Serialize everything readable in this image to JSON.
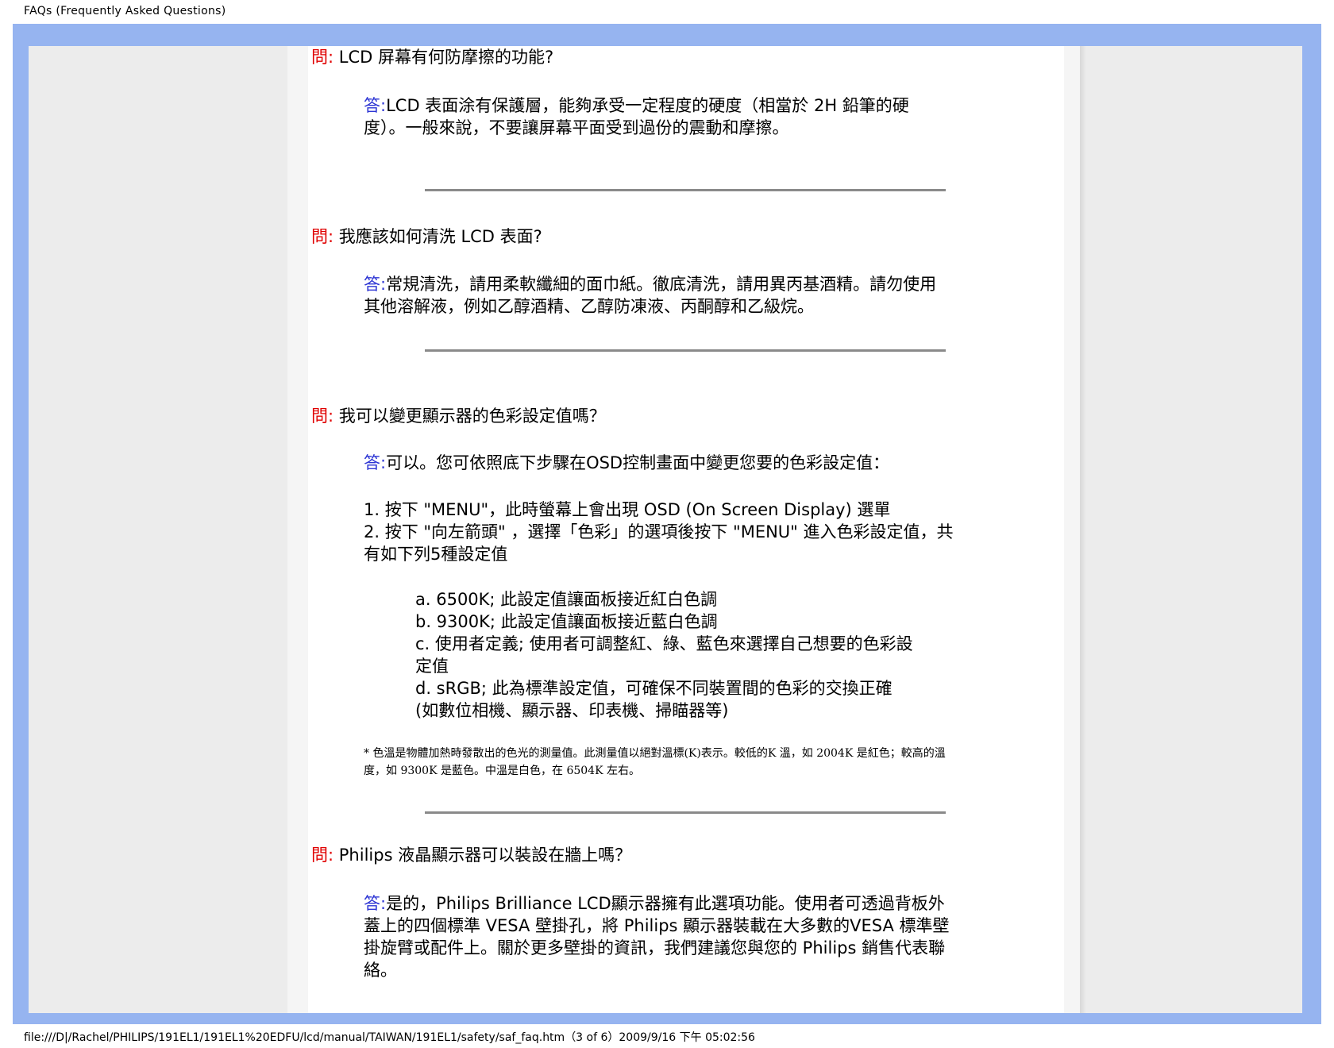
{
  "header": {
    "title": "FAQs (Frequently Asked Questions)"
  },
  "labels": {
    "q": "問:",
    "a": "答:"
  },
  "faq1": {
    "question": "LCD 屏幕有何防摩擦的功能?",
    "answer_l1": "LCD 表面涂有保護層，能夠承受一定程度的硬度（相當於 2H 鉛筆的硬",
    "answer_l2": "度）。一般來說，不要讓屏幕平面受到過份的震動和摩擦。"
  },
  "faq2": {
    "question": "我應該如何清洗 LCD 表面?",
    "answer_l1": "常規清洗，請用柔軟纖細的面巾紙。徹底清洗，請用異丙基酒精。請勿使用",
    "answer_l2": "其他溶解液，例如乙醇酒精、乙醇防凍液、丙酮醇和乙級烷。"
  },
  "faq3": {
    "question": "我可以變更顯示器的色彩設定值嗎？",
    "answer": "可以。您可依照底下步驟在OSD控制畫面中變更您要的色彩設定值：",
    "step1": "1. 按下 \"MENU\"，此時螢幕上會出現 OSD (On Screen Display) 選單",
    "step2_l1": "2. 按下 \"向左箭頭\" ，選擇「色彩」的選項後按下 \"MENU\" 進入色彩設定值，共",
    "step2_l2": "有如下列5種設定值",
    "opt_a": "a. 6500K; 此設定值讓面板接近紅白色調",
    "opt_b": "b. 9300K; 此設定值讓面板接近藍白色調",
    "opt_c_l1": "c. 使用者定義; 使用者可調整紅、綠、藍色來選擇自己想要的色彩設",
    "opt_c_l2": "定值",
    "opt_d_l1": "d. sRGB; 此為標準設定值，可確保不同裝置間的色彩的交換正確",
    "opt_d_l2": "(如數位相機、顯示器、印表機、掃瞄器等)",
    "note_l1": "* 色溫是物體加熱時發散出的色光的測量值。此測量值以絕對溫標(K)表示。較低的K 溫，如 2004K 是紅色；較高的溫",
    "note_l2": "度，如 9300K 是藍色。中溫是白色，在 6504K 左右。"
  },
  "faq4": {
    "question": "Philips 液晶顯示器可以裝設在牆上嗎？",
    "answer_l1": "是的，Philips Brilliance LCD顯示器擁有此選項功能。使用者可透過背板外",
    "answer_l2": "蓋上的四個標準 VESA 壁掛孔，將 Philips 顯示器裝載在大多數的VESA 標準壁",
    "answer_l3": "掛旋臂或配件上。關於更多壁掛的資訊，我們建議您與您的 Philips 銷售代表聯",
    "answer_l4": "絡。"
  },
  "footer": {
    "path": "file:///D|/Rachel/PHILIPS/191EL1/191EL1%20EDFU/lcd/manual/TAIWAN/191EL1/safety/saf_faq.htm（3 of 6）2009/9/16 下午 05:02:56"
  }
}
